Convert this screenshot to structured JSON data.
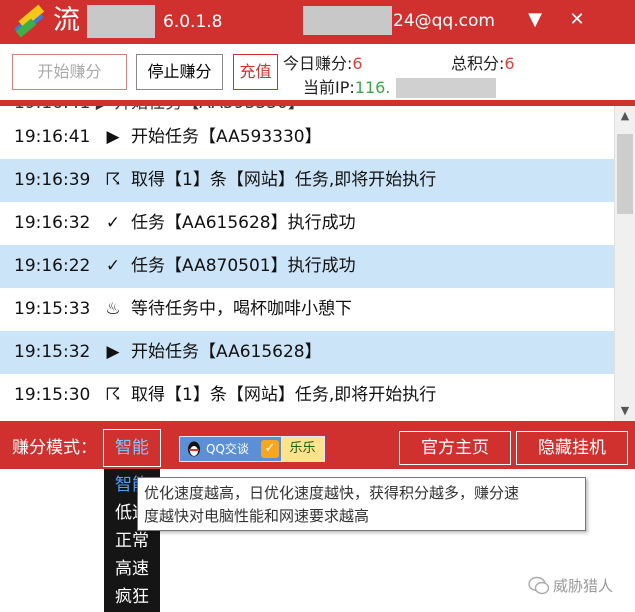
{
  "titlebar": {
    "app_name": "流",
    "version": "6.0.1.8",
    "account": "24@qq.com",
    "minimize": "▼",
    "close": "✕",
    "bg_color": "#d0312f"
  },
  "toolbar": {
    "start_label": "开始赚分",
    "stop_label": "停止赚分",
    "recharge_label": "充值",
    "today_label": "今日赚分:",
    "today_value": "6",
    "total_label": "总积分:",
    "total_value": "6",
    "ip_label": "当前IP:",
    "ip_value": "116."
  },
  "log": {
    "partial_text": "19:16:41 ▶ 开始任务【AA593330】",
    "rows": [
      {
        "time": "19:16:41",
        "icon": "▶",
        "icon_name": "play-icon",
        "text": "开始任务【AA593330】"
      },
      {
        "time": "19:16:39",
        "icon": "☈",
        "icon_name": "flag-icon",
        "text": "取得【1】条【网站】任务,即将开始执行"
      },
      {
        "time": "19:16:32",
        "icon": "✓",
        "icon_name": "check-icon",
        "text": "任务【AA615628】执行成功"
      },
      {
        "time": "19:16:22",
        "icon": "✓",
        "icon_name": "check-icon",
        "text": "任务【AA870501】执行成功"
      },
      {
        "time": "19:15:33",
        "icon": "♨",
        "icon_name": "coffee-icon",
        "text": "等待任务中，喝杯咖啡小憩下"
      },
      {
        "time": "19:15:32",
        "icon": "▶",
        "icon_name": "play-icon",
        "text": "开始任务【AA615628】"
      },
      {
        "time": "19:15:30",
        "icon": "☈",
        "icon_name": "flag-icon",
        "text": "取得【1】条【网站】任务,即将开始执行"
      }
    ]
  },
  "bottombar": {
    "mode_label": "赚分模式：",
    "mode_value": "智能",
    "qq_left": "QQ交谈",
    "qq_right": "乐乐",
    "home_label": "官方主页",
    "hide_label": "隐藏挂机"
  },
  "dropdown": {
    "options": [
      "智能",
      "低速",
      "正常",
      "高速",
      "疯狂"
    ]
  },
  "tooltip": {
    "line1": "优化速度越高，日优化速度越快，获得积分越多，赚分速",
    "line2": "度越快对电脑性能和网速要求越高"
  },
  "watermark": {
    "text": "威胁猎人"
  }
}
